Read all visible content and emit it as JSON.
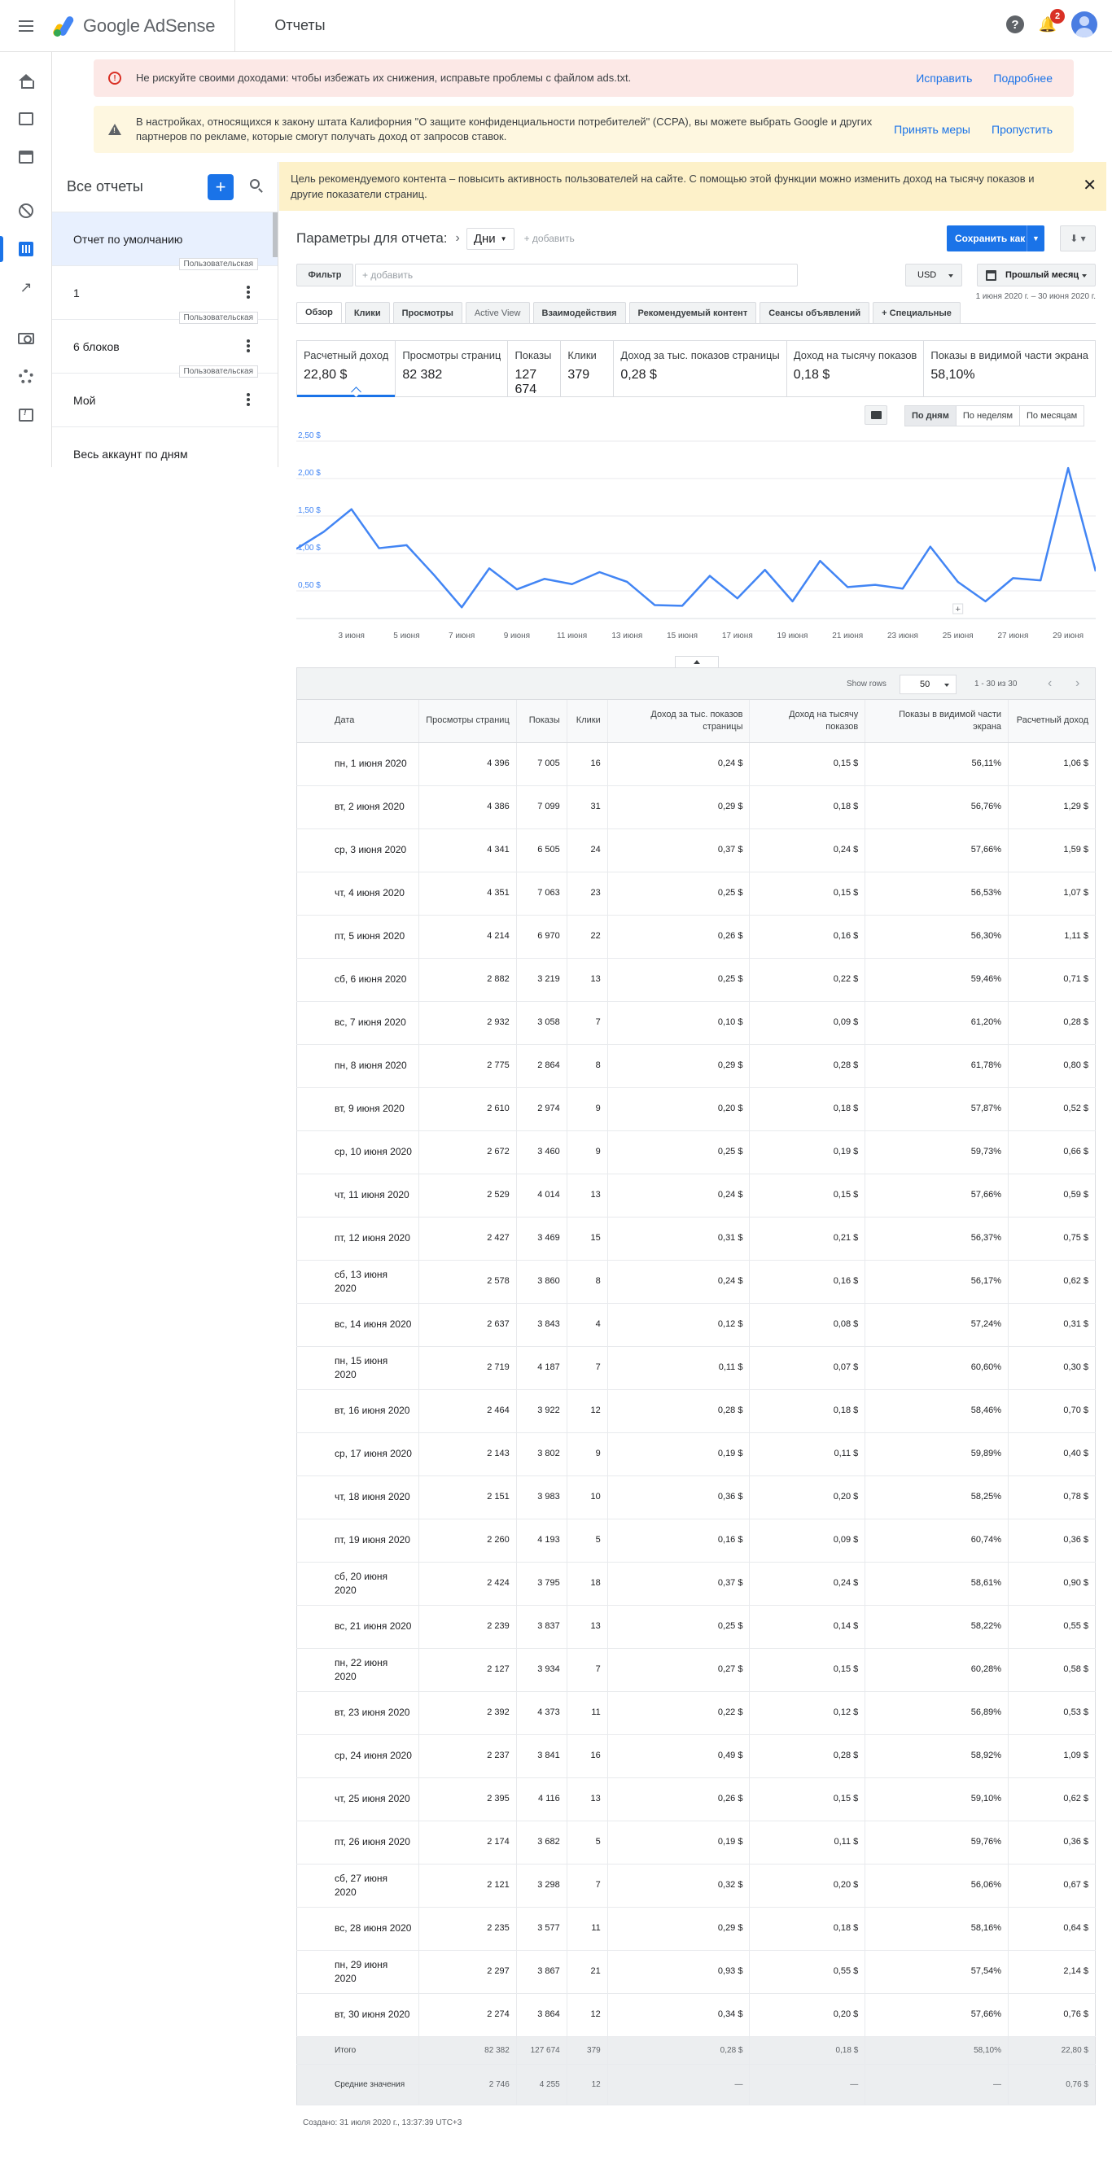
{
  "header": {
    "product": "Google AdSense",
    "page_title": "Отчеты",
    "notification_count": "2"
  },
  "alerts": {
    "ads_txt": {
      "text": "Не рискуйте своими доходами: чтобы избежать их снижения, исправьте проблемы с файлом ads.txt.",
      "action1": "Исправить",
      "action2": "Подробнее"
    },
    "ccpa": {
      "text": "В настройках, относящихся к закону штата Калифорния \"О защите конфиденциальности потребителей\" (CCPA), вы можете выбрать Google и других партнеров по рекламе, которые смогут получать доход от запросов ставок.",
      "action1": "Принять меры",
      "action2": "Пропустить"
    }
  },
  "reports_sidebar": {
    "title": "Все отчеты",
    "add": "+",
    "items": [
      {
        "label": "Отчет по умолчанию",
        "tag": ""
      },
      {
        "label": "1",
        "tag": "Пользовательская"
      },
      {
        "label": "6 блоков",
        "tag": "Пользовательская"
      },
      {
        "label": "Мой",
        "tag": "Пользовательская"
      },
      {
        "label": "Весь аккаунт по дням",
        "tag": ""
      }
    ]
  },
  "banner": {
    "text": "Цель рекомендуемого контента – повысить активность пользователей на сайте. С помощью этой функции можно изменить доход на тысячу показов и другие показатели страниц.",
    "close": "✕"
  },
  "params": {
    "label": "Параметры для отчета:",
    "dimension": "Дни",
    "add": "+ добавить",
    "save": "Сохранить как"
  },
  "filter": {
    "button": "Фильтр",
    "placeholder": "+ добавить",
    "currency": "USD",
    "period": "Прошлый месяц",
    "date_range": "1 июня 2020 г. – 30 июня 2020 г."
  },
  "tabs": [
    "Обзор",
    "Клики",
    "Просмотры",
    "Active View",
    "Взаимодействия",
    "Рекомендуемый контент",
    "Сеансы объявлений",
    "+ Специальные"
  ],
  "kpis": [
    {
      "label": "Расчетный доход",
      "value": "22,80 $"
    },
    {
      "label": "Просмотры страниц",
      "value": "82 382"
    },
    {
      "label": "Показы",
      "value": "127 674"
    },
    {
      "label": "Клики",
      "value": "379"
    },
    {
      "label": "Доход за тыс. показов страницы",
      "value": "0,28 $"
    },
    {
      "label": "Доход на тысячу показов",
      "value": "0,18 $"
    },
    {
      "label": "Показы в видимой части экрана",
      "value": "58,10%"
    }
  ],
  "granularity": [
    "По дням",
    "По неделям",
    "По месяцам"
  ],
  "chart_data": {
    "type": "line",
    "x": [
      1,
      2,
      3,
      4,
      5,
      6,
      7,
      8,
      9,
      10,
      11,
      12,
      13,
      14,
      15,
      16,
      17,
      18,
      19,
      20,
      21,
      22,
      23,
      24,
      25,
      26,
      27,
      28,
      29,
      30
    ],
    "x_tick_labels": [
      "3 июня",
      "5 июня",
      "7 июня",
      "9 июня",
      "11 июня",
      "13 июня",
      "15 июня",
      "17 июня",
      "19 июня",
      "21 июня",
      "23 июня",
      "25 июня",
      "27 июня",
      "29 июня"
    ],
    "x_tick_days": [
      3,
      5,
      7,
      9,
      11,
      13,
      15,
      17,
      19,
      21,
      23,
      25,
      27,
      29
    ],
    "series": [
      {
        "values": [
          1.06,
          1.29,
          1.59,
          1.07,
          1.11,
          0.71,
          0.28,
          0.8,
          0.52,
          0.66,
          0.59,
          0.75,
          0.62,
          0.31,
          0.3,
          0.7,
          0.4,
          0.78,
          0.36,
          0.9,
          0.55,
          0.58,
          0.53,
          1.09,
          0.62,
          0.36,
          0.67,
          0.64,
          2.14,
          0.76
        ]
      }
    ],
    "y_ticks": [
      0.5,
      1.0,
      1.5,
      2.0,
      2.5
    ],
    "y_tick_labels": [
      "0,50 $",
      "1,00 $",
      "1,50 $",
      "2,00 $",
      "2,50 $"
    ],
    "ylim": [
      0,
      2.5
    ],
    "grid": true,
    "color": "#4285f4"
  },
  "table": {
    "show_rows_label": "Show rows",
    "rows": "50",
    "range": "1 - 30 из 30",
    "columns": [
      "Дата",
      "Просмотры страниц",
      "Показы",
      "Клики",
      "Доход за тыс. показов страницы",
      "Доход на тысячу показов",
      "Показы в видимой части экрана",
      "Расчетный доход"
    ],
    "data": [
      [
        "пн, 1 июня 2020",
        "4 396",
        "7 005",
        "16",
        "0,24 $",
        "0,15 $",
        "56,11%",
        "1,06 $"
      ],
      [
        "вт, 2 июня 2020",
        "4 386",
        "7 099",
        "31",
        "0,29 $",
        "0,18 $",
        "56,76%",
        "1,29 $"
      ],
      [
        "ср, 3 июня 2020",
        "4 341",
        "6 505",
        "24",
        "0,37 $",
        "0,24 $",
        "57,66%",
        "1,59 $"
      ],
      [
        "чт, 4 июня 2020",
        "4 351",
        "7 063",
        "23",
        "0,25 $",
        "0,15 $",
        "56,53%",
        "1,07 $"
      ],
      [
        "пт, 5 июня 2020",
        "4 214",
        "6 970",
        "22",
        "0,26 $",
        "0,16 $",
        "56,30%",
        "1,11 $"
      ],
      [
        "сб, 6 июня 2020",
        "2 882",
        "3 219",
        "13",
        "0,25 $",
        "0,22 $",
        "59,46%",
        "0,71 $"
      ],
      [
        "вс, 7 июня 2020",
        "2 932",
        "3 058",
        "7",
        "0,10 $",
        "0,09 $",
        "61,20%",
        "0,28 $"
      ],
      [
        "пн, 8 июня 2020",
        "2 775",
        "2 864",
        "8",
        "0,29 $",
        "0,28 $",
        "61,78%",
        "0,80 $"
      ],
      [
        "вт, 9 июня 2020",
        "2 610",
        "2 974",
        "9",
        "0,20 $",
        "0,18 $",
        "57,87%",
        "0,52 $"
      ],
      [
        "ср, 10 июня 2020",
        "2 672",
        "3 460",
        "9",
        "0,25 $",
        "0,19 $",
        "59,73%",
        "0,66 $"
      ],
      [
        "чт, 11 июня 2020",
        "2 529",
        "4 014",
        "13",
        "0,24 $",
        "0,15 $",
        "57,66%",
        "0,59 $"
      ],
      [
        "пт, 12 июня 2020",
        "2 427",
        "3 469",
        "15",
        "0,31 $",
        "0,21 $",
        "56,37%",
        "0,75 $"
      ],
      [
        "сб, 13 июня 2020",
        "2 578",
        "3 860",
        "8",
        "0,24 $",
        "0,16 $",
        "56,17%",
        "0,62 $"
      ],
      [
        "вс, 14 июня 2020",
        "2 637",
        "3 843",
        "4",
        "0,12 $",
        "0,08 $",
        "57,24%",
        "0,31 $"
      ],
      [
        "пн, 15 июня 2020",
        "2 719",
        "4 187",
        "7",
        "0,11 $",
        "0,07 $",
        "60,60%",
        "0,30 $"
      ],
      [
        "вт, 16 июня 2020",
        "2 464",
        "3 922",
        "12",
        "0,28 $",
        "0,18 $",
        "58,46%",
        "0,70 $"
      ],
      [
        "ср, 17 июня 2020",
        "2 143",
        "3 802",
        "9",
        "0,19 $",
        "0,11 $",
        "59,89%",
        "0,40 $"
      ],
      [
        "чт, 18 июня 2020",
        "2 151",
        "3 983",
        "10",
        "0,36 $",
        "0,20 $",
        "58,25%",
        "0,78 $"
      ],
      [
        "пт, 19 июня 2020",
        "2 260",
        "4 193",
        "5",
        "0,16 $",
        "0,09 $",
        "60,74%",
        "0,36 $"
      ],
      [
        "сб, 20 июня 2020",
        "2 424",
        "3 795",
        "18",
        "0,37 $",
        "0,24 $",
        "58,61%",
        "0,90 $"
      ],
      [
        "вс, 21 июня 2020",
        "2 239",
        "3 837",
        "13",
        "0,25 $",
        "0,14 $",
        "58,22%",
        "0,55 $"
      ],
      [
        "пн, 22 июня 2020",
        "2 127",
        "3 934",
        "7",
        "0,27 $",
        "0,15 $",
        "60,28%",
        "0,58 $"
      ],
      [
        "вт, 23 июня 2020",
        "2 392",
        "4 373",
        "11",
        "0,22 $",
        "0,12 $",
        "56,89%",
        "0,53 $"
      ],
      [
        "ср, 24 июня 2020",
        "2 237",
        "3 841",
        "16",
        "0,49 $",
        "0,28 $",
        "58,92%",
        "1,09 $"
      ],
      [
        "чт, 25 июня 2020",
        "2 395",
        "4 116",
        "13",
        "0,26 $",
        "0,15 $",
        "59,10%",
        "0,62 $"
      ],
      [
        "пт, 26 июня 2020",
        "2 174",
        "3 682",
        "5",
        "0,19 $",
        "0,11 $",
        "59,76%",
        "0,36 $"
      ],
      [
        "сб, 27 июня 2020",
        "2 121",
        "3 298",
        "7",
        "0,32 $",
        "0,20 $",
        "56,06%",
        "0,67 $"
      ],
      [
        "вс, 28 июня 2020",
        "2 235",
        "3 577",
        "11",
        "0,29 $",
        "0,18 $",
        "58,16%",
        "0,64 $"
      ],
      [
        "пн, 29 июня 2020",
        "2 297",
        "3 867",
        "21",
        "0,93 $",
        "0,55 $",
        "57,54%",
        "2,14 $"
      ],
      [
        "вт, 30 июня 2020",
        "2 274",
        "3 864",
        "12",
        "0,34 $",
        "0,20 $",
        "57,66%",
        "0,76 $"
      ]
    ],
    "total": [
      "Итого",
      "82 382",
      "127 674",
      "379",
      "0,28 $",
      "0,18 $",
      "58,10%",
      "22,80 $"
    ],
    "average": [
      "Средние значения",
      "2 746",
      "4 255",
      "12",
      "—",
      "—",
      "—",
      "0,76 $"
    ]
  },
  "created": "Создано: 31 июля 2020 г., 13:37:39 UTC+3"
}
